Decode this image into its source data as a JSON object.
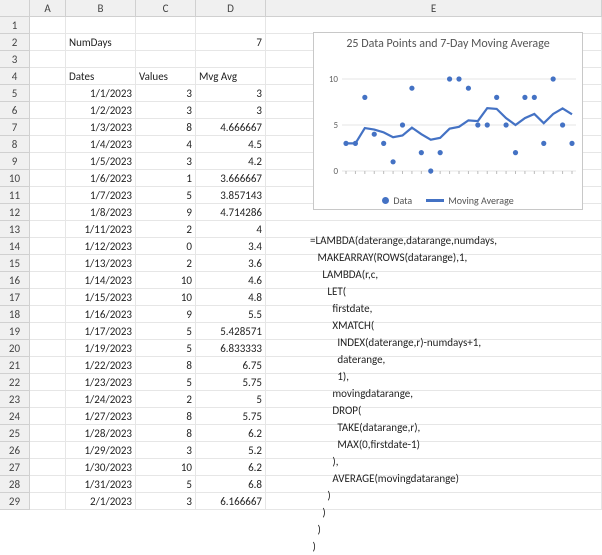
{
  "columns": [
    "A",
    "B",
    "C",
    "D",
    "E"
  ],
  "row_count": 29,
  "labels": {
    "numdays": "NumDays",
    "dates": "Dates",
    "values": "Values",
    "mvgavg": "Mvg Avg"
  },
  "numdays_value": 7,
  "table": [
    {
      "date": "1/1/2023",
      "val": 3,
      "avg": "3"
    },
    {
      "date": "1/2/2023",
      "val": 3,
      "avg": "3"
    },
    {
      "date": "1/3/2023",
      "val": 8,
      "avg": "4.666667"
    },
    {
      "date": "1/4/2023",
      "val": 4,
      "avg": "4.5"
    },
    {
      "date": "1/5/2023",
      "val": 3,
      "avg": "4.2"
    },
    {
      "date": "1/6/2023",
      "val": 1,
      "avg": "3.666667"
    },
    {
      "date": "1/7/2023",
      "val": 5,
      "avg": "3.857143"
    },
    {
      "date": "1/8/2023",
      "val": 9,
      "avg": "4.714286"
    },
    {
      "date": "1/11/2023",
      "val": 2,
      "avg": "4"
    },
    {
      "date": "1/12/2023",
      "val": 0,
      "avg": "3.4"
    },
    {
      "date": "1/13/2023",
      "val": 2,
      "avg": "3.6"
    },
    {
      "date": "1/14/2023",
      "val": 10,
      "avg": "4.6"
    },
    {
      "date": "1/15/2023",
      "val": 10,
      "avg": "4.8"
    },
    {
      "date": "1/16/2023",
      "val": 9,
      "avg": "5.5"
    },
    {
      "date": "1/17/2023",
      "val": 5,
      "avg": "5.428571"
    },
    {
      "date": "1/19/2023",
      "val": 5,
      "avg": "6.833333"
    },
    {
      "date": "1/22/2023",
      "val": 8,
      "avg": "6.75"
    },
    {
      "date": "1/23/2023",
      "val": 5,
      "avg": "5.75"
    },
    {
      "date": "1/24/2023",
      "val": 2,
      "avg": "5"
    },
    {
      "date": "1/27/2023",
      "val": 8,
      "avg": "5.75"
    },
    {
      "date": "1/28/2023",
      "val": 8,
      "avg": "6.2"
    },
    {
      "date": "1/29/2023",
      "val": 3,
      "avg": "5.2"
    },
    {
      "date": "1/30/2023",
      "val": 10,
      "avg": "6.2"
    },
    {
      "date": "1/31/2023",
      "val": 5,
      "avg": "6.8"
    },
    {
      "date": "2/1/2023",
      "val": 3,
      "avg": "6.166667"
    }
  ],
  "chart_data": {
    "type": "scatter+line",
    "title": "25 Data Points and 7-Day Moving Average",
    "ylim": [
      0,
      10
    ],
    "yticks": [
      0,
      5,
      10
    ],
    "series": [
      {
        "name": "Data",
        "type": "scatter",
        "values": [
          3,
          3,
          8,
          4,
          3,
          1,
          5,
          9,
          2,
          0,
          2,
          10,
          10,
          9,
          5,
          5,
          8,
          5,
          2,
          8,
          8,
          3,
          10,
          5,
          3
        ]
      },
      {
        "name": "Moving Average",
        "type": "line",
        "values": [
          3,
          3,
          4.666667,
          4.5,
          4.2,
          3.666667,
          3.857143,
          4.714286,
          4,
          3.4,
          3.6,
          4.6,
          4.8,
          5.5,
          5.428571,
          6.833333,
          6.75,
          5.75,
          5,
          5.75,
          6.2,
          5.2,
          6.2,
          6.8,
          6.166667
        ]
      }
    ],
    "legend": [
      "Data",
      "Moving Average"
    ]
  },
  "formula_lines": [
    "=LAMBDA(daterange,datarange,numdays,",
    "   MAKEARRAY(ROWS(datarange),1,",
    "     LAMBDA(r,c,",
    "       LET(",
    "         firstdate,",
    "         XMATCH(",
    "           INDEX(daterange,r)-numdays+1,",
    "           daterange,",
    "           1),",
    "         movingdatarange,",
    "         DROP(",
    "           TAKE(datarange,r),",
    "           MAX(0,firstdate-1)",
    "         ),",
    "         AVERAGE(movingdatarange)",
    "       )",
    "     )",
    "   )",
    " )"
  ]
}
